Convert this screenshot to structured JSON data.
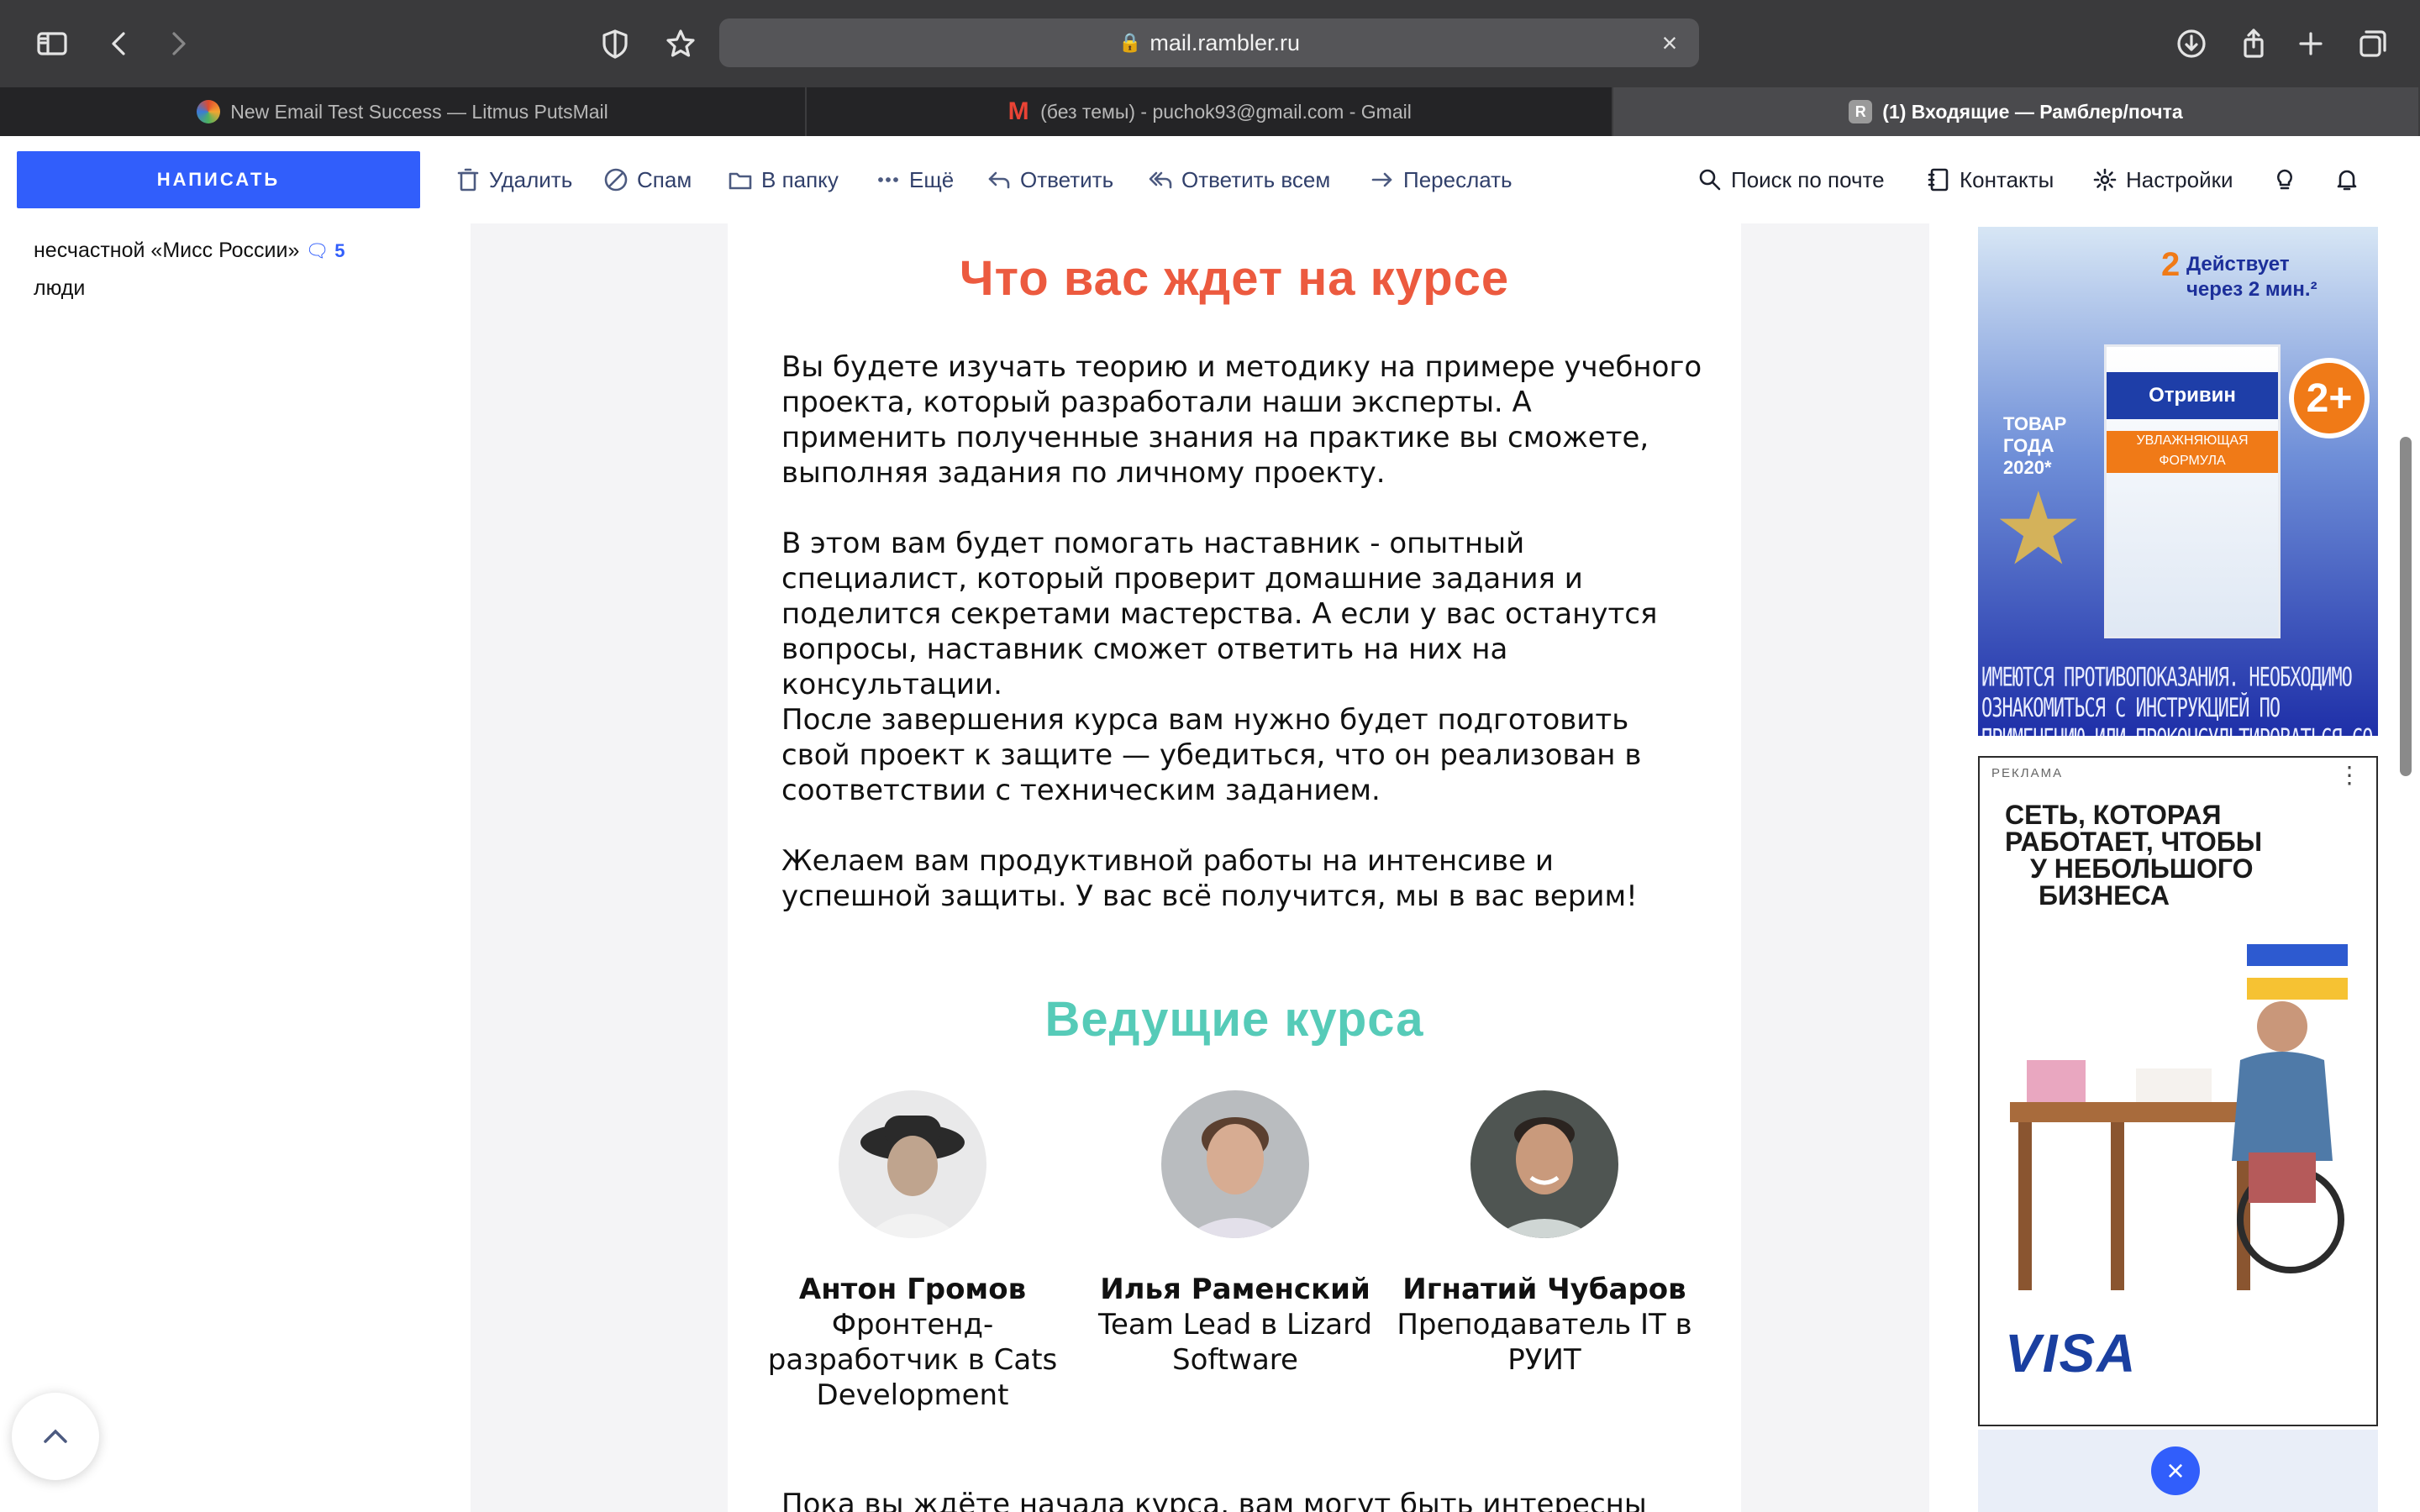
{
  "browser": {
    "url": "mail.rambler.ru",
    "tabs": [
      {
        "title": "New Email Test Success — Litmus PutsMail",
        "favicon": "litmus-icon"
      },
      {
        "title": "(без темы) - puchok93@gmail.com - Gmail",
        "favicon": "gmail-icon",
        "favicon_text": "M"
      },
      {
        "title": "(1) Входящие — Рамблер/почта",
        "favicon": "rambler-icon",
        "favicon_text": "R",
        "active": true
      }
    ]
  },
  "toolbar": {
    "compose_label": "НАПИСАТЬ",
    "actions": {
      "delete": "Удалить",
      "spam": "Спам",
      "move": "В папку",
      "more": "Ещё",
      "reply": "Ответить",
      "reply_all": "Ответить всем",
      "forward": "Переслать"
    },
    "right": {
      "search": "Поиск по почте",
      "contacts": "Контакты",
      "settings": "Настройки"
    },
    "accent": "#315efb"
  },
  "sidebar": {
    "snippet_line1": "несчастной «Мисс России»",
    "comment_count": "5",
    "snippet_line2": "люди"
  },
  "email": {
    "heading_course": "Что вас ждет на курсе",
    "heading_course_color": "#ec5a3f",
    "para1": "Вы будете изучать теорию и методику на примере учебного проекта, который разработали наши эксперты. А применить полученные знания на практике вы сможете, выполняя задания по личному проекту.",
    "para2": "В этом вам будет помогать наставник - опытный специалист, который проверит домашние задания и поделится секретами мастерства. А если у вас останутся вопросы, наставник сможет ответить на них на консультации.",
    "para3": "После завершения курса вам нужно будет подготовить свой проект к защите — убедиться, что он реализован в соответствии с техническим заданием.",
    "para4": "Желаем вам продуктивной работы на интенсиве и успешной защиты. У вас всё получится, мы в вас верим!",
    "heading_leads": "Ведущие курса",
    "heading_leads_color": "#56cbb8",
    "mentors": [
      {
        "name": "Антон Громов",
        "role": "Фронтенд-разработчик в Cats Development"
      },
      {
        "name": "Илья Раменский",
        "role": "Team Lead в Lizard Software"
      },
      {
        "name": "Игнатий Чубаров",
        "role": "Преподаватель IT в РУИТ"
      }
    ],
    "cut_line": "Пока вы ждёте начала курса, вам могут быть интересны"
  },
  "ads": {
    "ad1": {
      "action_num": "2",
      "action_text_1": "Действует",
      "action_text_2": "через 2 мин.²",
      "badge": "2+",
      "product": "Отривин",
      "product_sub": "УВЛАЖНЯЮЩАЯ ФОРМУЛА",
      "award_1": "ТОВАР",
      "award_2": "ГОДА",
      "award_3": "2020*",
      "disclaimer": "ИМЕЮТСЯ ПРОТИВОПОКАЗАНИЯ. НЕОБХОДИМО ОЗНАКОМИТЬСЯ С ИНСТРУКЦИЕЙ ПО ПРИМЕНЕНИЮ ИЛИ ПРОКОНСУЛЬТИРОВАТЬСЯ СО СПЕЦИАЛИСТОМ"
    },
    "ad2": {
      "label": "РЕКЛАМА",
      "headline_1": "СЕТЬ, КОТОРАЯ",
      "headline_2": "РАБОТАЕТ, ЧТОБЫ",
      "headline_3": "У НЕБОЛЬШОГО",
      "headline_4": "БИЗНЕСА",
      "brand": "VISA"
    }
  }
}
